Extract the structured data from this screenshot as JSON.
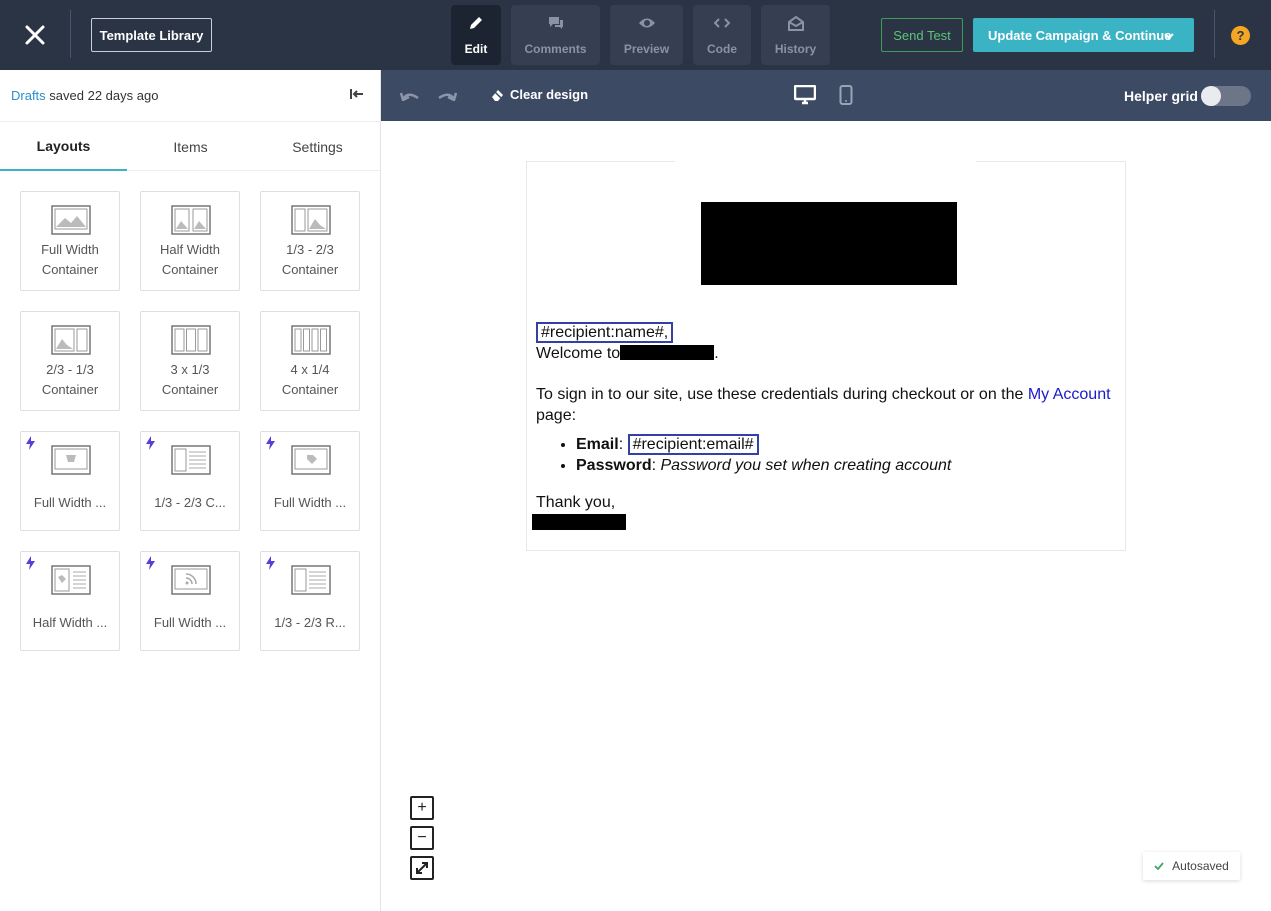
{
  "topbar": {
    "template_library": "Template Library",
    "tabs": [
      {
        "label": "Edit",
        "icon": "pencil-icon"
      },
      {
        "label": "Comments",
        "icon": "comments-icon"
      },
      {
        "label": "Preview",
        "icon": "eye-icon"
      },
      {
        "label": "Code",
        "icon": "code-icon"
      },
      {
        "label": "History",
        "icon": "history-icon"
      }
    ],
    "send_test": "Send Test",
    "update_campaign": "Update Campaign & Continue",
    "help": "?"
  },
  "sidebar": {
    "drafts_link": "Drafts",
    "saved_text": " saved 22 days ago",
    "tabs": [
      "Layouts",
      "Items",
      "Settings"
    ],
    "layouts": [
      {
        "label": "Full Width Container",
        "premium": false
      },
      {
        "label": "Half Width Container",
        "premium": false
      },
      {
        "label": "1/3 - 2/3 Container",
        "premium": false
      },
      {
        "label": "2/3 - 1/3 Container",
        "premium": false
      },
      {
        "label": "3 x 1/3 Container",
        "premium": false
      },
      {
        "label": "4 x 1/4 Container",
        "premium": false
      },
      {
        "label": "Full Width ...",
        "premium": true
      },
      {
        "label": "1/3 - 2/3 C...",
        "premium": true
      },
      {
        "label": "Full Width ...",
        "premium": true
      },
      {
        "label": "Half Width ...",
        "premium": true
      },
      {
        "label": "Full Width ...",
        "premium": true
      },
      {
        "label": "1/3 - 2/3 R...",
        "premium": true
      }
    ]
  },
  "toolbar": {
    "clear_design": "Clear design",
    "helper_grid": "Helper grid",
    "helper_grid_on": false
  },
  "email": {
    "name_tag": "#recipient:name#,",
    "welcome": "Welcome to",
    "signin_text": "To sign in to our site, use these credentials during checkout or on the ",
    "my_account": "My Account",
    "page_text": "page:",
    "email_label": "Email",
    "email_tag": "#recipient:email#",
    "password_label": "Password",
    "password_value": "Password you set when creating account",
    "thanks": "Thank you,"
  },
  "zoom": {
    "in": "+",
    "out": "−"
  },
  "autosaved": "Autosaved",
  "colors": {
    "accent": "#3ab3c4",
    "topbar": "#2b3445",
    "toolbar": "#3d4a63",
    "send_test": "#5cc477",
    "help": "#f5a623",
    "premium_bolt": "#5a3fd6"
  }
}
